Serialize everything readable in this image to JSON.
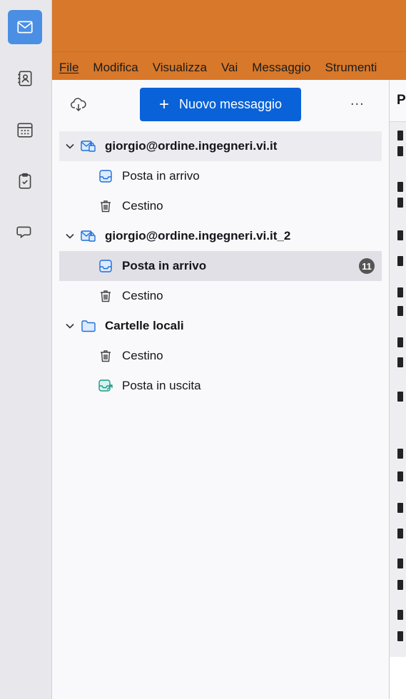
{
  "spaces": {
    "items": [
      {
        "name": "mail",
        "icon": "envelope-icon",
        "active": true
      },
      {
        "name": "address-book",
        "icon": "address-book-icon",
        "active": false
      },
      {
        "name": "calendar",
        "icon": "calendar-icon",
        "active": false
      },
      {
        "name": "tasks",
        "icon": "tasks-icon",
        "active": false
      },
      {
        "name": "chat",
        "icon": "chat-icon",
        "active": false
      }
    ]
  },
  "colors": {
    "titlebar": "#d7782a",
    "accent_button": "#0a62d9",
    "active_space": "#4a8fe3"
  },
  "menubar": {
    "items": [
      "File",
      "Modifica",
      "Visualizza",
      "Vai",
      "Messaggio",
      "Strumenti"
    ]
  },
  "folder_pane": {
    "new_message_label": "Nuovo messaggio",
    "more_label": "...",
    "accounts": [
      {
        "name": "giorgio@ordine.ingegneri.vi.it",
        "folders": [
          {
            "name": "Posta in arrivo",
            "icon": "inbox-icon"
          },
          {
            "name": "Cestino",
            "icon": "trash-icon"
          }
        ]
      },
      {
        "name": "giorgio@ordine.ingegneri.vi.it_2",
        "folders": [
          {
            "name": "Posta in arrivo",
            "icon": "inbox-icon",
            "unread": "11",
            "selected": true
          },
          {
            "name": "Cestino",
            "icon": "trash-icon"
          }
        ]
      },
      {
        "name": "Cartelle locali",
        "folders": [
          {
            "name": "Cestino",
            "icon": "trash-icon"
          },
          {
            "name": "Posta in uscita",
            "icon": "outbox-icon"
          }
        ]
      }
    ]
  },
  "message_pane": {
    "header_partial": "P"
  }
}
